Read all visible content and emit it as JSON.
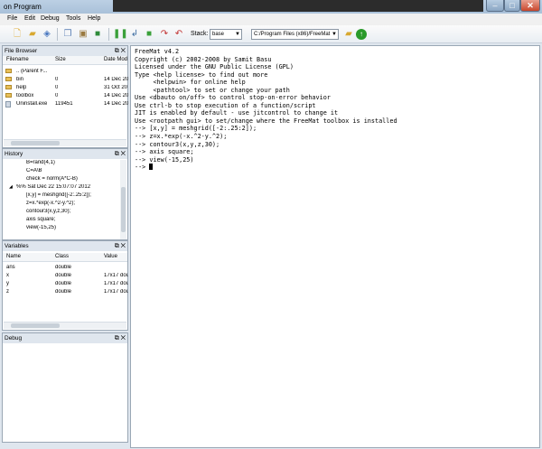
{
  "window": {
    "title": "on Program"
  },
  "menu": [
    "File",
    "Edit",
    "Debug",
    "Tools",
    "Help"
  ],
  "toolbar": {
    "stack_label": "Stack:",
    "stack_value": "base",
    "path_value": "C:/Program Files (x86)/FreeMat"
  },
  "file_browser": {
    "title": "File Browser",
    "columns": [
      "Filename",
      "Size",
      "Date Mod"
    ],
    "rows": [
      {
        "name": ".. (Parent F...",
        "size": "",
        "date": "",
        "icon": "folder-icon"
      },
      {
        "name": "bin",
        "size": "0",
        "date": "14 Dec 20",
        "icon": "folder-icon"
      },
      {
        "name": "help",
        "size": "0",
        "date": "31 Oct 20",
        "icon": "folder-icon"
      },
      {
        "name": "toolbox",
        "size": "0",
        "date": "14 Dec 20",
        "icon": "folder-icon"
      },
      {
        "name": "Uninstall.exe",
        "size": "119451",
        "date": "14 Dec 20",
        "icon": "file-icon"
      }
    ]
  },
  "history": {
    "title": "History",
    "lines": [
      "B=rand(4,1)",
      "C=A\\B",
      "check = norm(A*C-B)",
      "%% Sat Dec 22 15:07:07 2012",
      "[x,y] = meshgrid([-2:.25:2]);",
      "z=x.*exp(-x.^2-y.^2);",
      "contour3(x,y,z,30);",
      "axis square;",
      "view(-15,25)"
    ]
  },
  "variables": {
    "title": "Variables",
    "columns": [
      "Name",
      "Class",
      "Value"
    ],
    "rows": [
      {
        "name": "ans",
        "class": "double",
        "value": ""
      },
      {
        "name": "x",
        "class": "double",
        "value": "17x17 dou"
      },
      {
        "name": "y",
        "class": "double",
        "value": "17x17 dou"
      },
      {
        "name": "z",
        "class": "double",
        "value": "17x17 dou"
      }
    ]
  },
  "debug": {
    "title": "Debug"
  },
  "console": {
    "lines": [
      "FreeMat v4.2",
      "Copyright (c) 2002-2008 by Samit Basu",
      "Licensed under the GNU Public License (GPL)",
      "Type <help license> to find out more",
      "     <helpwin> for online help",
      "     <pathtool> to set or change your path",
      "Use <dbauto on/off> to control stop-on-error behavior",
      "Use ctrl-b to stop execution of a function/script",
      "JIT is enabled by default - use jitcontrol to change it",
      "Use <rootpath gui> to set/change where the FreeMat toolbox is installed",
      "--> [x,y] = meshgrid([-2:.25:2]);",
      "--> z=x.*exp(-x.^2-y.^2);",
      "--> contour3(x,y,z,30);",
      "--> axis square;",
      "--> view(-15,25)"
    ],
    "prompt": "--> "
  }
}
